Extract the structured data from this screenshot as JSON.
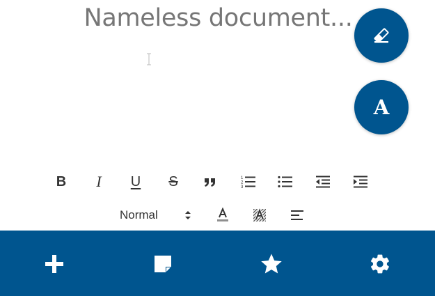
{
  "document": {
    "title": "Nameless document..."
  },
  "fabs": {
    "clear_icon": "eraser-icon",
    "font_icon": "font-letter-icon",
    "font_letter": "A"
  },
  "toolbar": {
    "bold": "B",
    "italic": "I",
    "underline": "U",
    "strike": "S",
    "quote_icon": "blockquote-icon",
    "ordered_list_icon": "ordered-list-icon",
    "bullet_list_icon": "bullet-list-icon",
    "outdent_icon": "outdent-icon",
    "indent_icon": "indent-icon",
    "header_select": "Normal",
    "text_color_icon": "text-color-icon",
    "background_color_icon": "background-color-icon",
    "align_icon": "align-left-icon"
  },
  "nav": {
    "items": [
      "add-icon",
      "note-icon",
      "star-icon",
      "gear-icon"
    ]
  },
  "colors": {
    "primary": "#00558f",
    "text": "#333333",
    "title": "#767676",
    "background": "#ffffff"
  }
}
